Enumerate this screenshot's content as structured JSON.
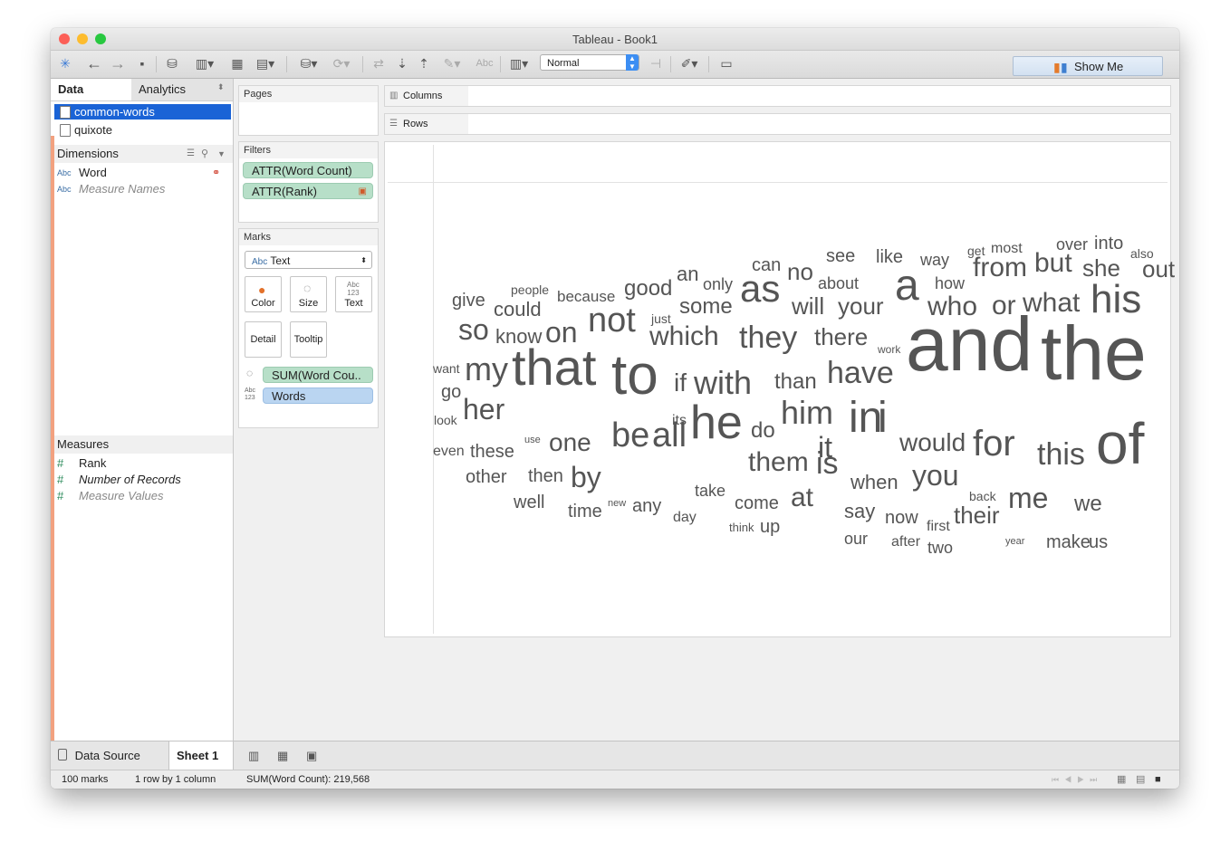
{
  "window": {
    "title": "Tableau - Book1"
  },
  "toolbar": {
    "fit_value": "Normal",
    "show_me_label": "Show Me"
  },
  "left_panel": {
    "tabs": [
      {
        "label": "Data"
      },
      {
        "label": "Analytics"
      }
    ],
    "data_sources": [
      {
        "label": "common-words",
        "selected": true
      },
      {
        "label": "quixote",
        "selected": false
      }
    ],
    "dimensions_header": "Dimensions",
    "dimensions": [
      {
        "type": "Abc",
        "label": "Word"
      },
      {
        "type": "Abc",
        "label": "Measure Names"
      }
    ],
    "measures_header": "Measures",
    "measures": [
      {
        "type": "#",
        "label": "Rank"
      },
      {
        "type": "#",
        "label": "Number of Records"
      },
      {
        "type": "#",
        "label": "Measure Values"
      }
    ]
  },
  "cards": {
    "pages_label": "Pages",
    "filters_label": "Filters",
    "filters": [
      "ATTR(Word Count)",
      "ATTR(Rank)"
    ],
    "marks_label": "Marks",
    "mark_type": "Text",
    "mark_type_icon": "Abc",
    "mark_buttons": [
      "Color",
      "Size",
      "Text",
      "Detail",
      "Tooltip"
    ],
    "mark_fields": [
      {
        "label": "SUM(Word Cou..",
        "kind": "size"
      },
      {
        "label": "Words",
        "kind": "text"
      }
    ]
  },
  "shelves": {
    "columns_label": "Columns",
    "rows_label": "Rows"
  },
  "word_cloud": [
    [
      "and",
      84
    ],
    [
      "the",
      84
    ],
    [
      "of",
      64
    ],
    [
      "to",
      62
    ],
    [
      "that",
      56
    ],
    [
      "he",
      52
    ],
    [
      "a",
      48
    ],
    [
      "in",
      48
    ],
    [
      "i",
      48
    ],
    [
      "his",
      44
    ],
    [
      "as",
      42
    ],
    [
      "not",
      38
    ],
    [
      "my",
      36
    ],
    [
      "with",
      36
    ],
    [
      "her",
      32
    ],
    [
      "it",
      32
    ],
    [
      "be",
      38
    ],
    [
      "all",
      38
    ],
    [
      "him",
      36
    ],
    [
      "for",
      40
    ],
    [
      "this",
      34
    ],
    [
      "is",
      34
    ],
    [
      "have",
      34
    ],
    [
      "they",
      34
    ],
    [
      "which",
      30
    ],
    [
      "on",
      32
    ],
    [
      "so",
      32
    ],
    [
      "by",
      32
    ],
    [
      "you",
      32
    ],
    [
      "me",
      32
    ],
    [
      "from",
      30
    ],
    [
      "but",
      30
    ],
    [
      "who",
      30
    ],
    [
      "or",
      30
    ],
    [
      "what",
      30
    ],
    [
      "them",
      30
    ],
    [
      "at",
      30
    ],
    [
      "one",
      28
    ],
    [
      "would",
      28
    ],
    [
      "if",
      28
    ],
    [
      "will",
      26
    ],
    [
      "your",
      26
    ],
    [
      "there",
      26
    ],
    [
      "no",
      26
    ],
    [
      "than",
      24
    ],
    [
      "do",
      24
    ],
    [
      "some",
      24
    ],
    [
      "good",
      24
    ],
    [
      "she",
      26
    ],
    [
      "out",
      26
    ],
    [
      "could",
      22
    ],
    [
      "know",
      22
    ],
    [
      "give",
      20
    ],
    [
      "go",
      20
    ],
    [
      "these",
      20
    ],
    [
      "other",
      20
    ],
    [
      "then",
      20
    ],
    [
      "well",
      20
    ],
    [
      "time",
      20
    ],
    [
      "any",
      20
    ],
    [
      "say",
      22
    ],
    [
      "when",
      22
    ],
    [
      "come",
      20
    ],
    [
      "up",
      20
    ],
    [
      "now",
      20
    ],
    [
      "their",
      26
    ],
    [
      "we",
      24
    ],
    [
      "make",
      20
    ],
    [
      "us",
      20
    ],
    [
      "our",
      18
    ],
    [
      "two",
      18
    ],
    [
      "after",
      16
    ],
    [
      "first",
      16
    ],
    [
      "back",
      14
    ],
    [
      "take",
      18
    ],
    [
      "an",
      22
    ],
    [
      "only",
      18
    ],
    [
      "can",
      20
    ],
    [
      "about",
      18
    ],
    [
      "see",
      20
    ],
    [
      "like",
      20
    ],
    [
      "way",
      18
    ],
    [
      "how",
      18
    ],
    [
      "get",
      14
    ],
    [
      "most",
      16
    ],
    [
      "over",
      18
    ],
    [
      "into",
      20
    ],
    [
      "also",
      14
    ],
    [
      "people",
      14
    ],
    [
      "because",
      17
    ],
    [
      "just",
      14
    ],
    [
      "work",
      12
    ],
    [
      "want",
      14
    ],
    [
      "look",
      14
    ],
    [
      "its",
      16
    ],
    [
      "use",
      11
    ],
    [
      "even",
      16
    ],
    [
      "new",
      11
    ],
    [
      "day",
      16
    ],
    [
      "think",
      13
    ],
    [
      "year",
      11
    ]
  ],
  "sheet_tabs": {
    "data_source_label": "Data Source",
    "sheet_label": "Sheet 1"
  },
  "status": {
    "marks": "100 marks",
    "dims": "1 row by 1 column",
    "sum": "SUM(Word Count): 219,568"
  }
}
